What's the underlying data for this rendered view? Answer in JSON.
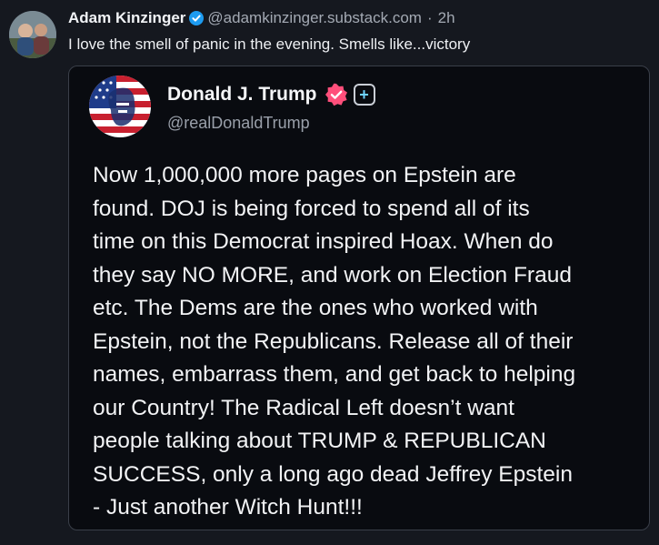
{
  "post": {
    "author_name": "Adam Kinzinger",
    "author_handle": "@adamkinzinger.substack.com",
    "separator": "·",
    "time": "2h",
    "text": "I love the smell of panic in the evening.  Smells like...victory",
    "verified_icon": "verified-check-icon"
  },
  "quote": {
    "author_name": "Donald J. Trump",
    "author_handle": "@realDonaldTrump",
    "verified_icon": "verified-badge-icon",
    "plus_icon": "plus-icon",
    "plus_glyph": "+",
    "body_lines": [
      "Now 1,000,000 more pages on Epstein are",
      "found. DOJ is being forced to spend all of its",
      "time on this Democrat inspired Hoax. When do",
      "they say NO MORE, and work on Election Fraud",
      "etc. The Dems are the ones who worked with",
      "Epstein, not the Republicans. Release all of their",
      "names, embarrass them, and get back to helping",
      "our Country! The Radical Left doesn’t want",
      "people talking about TRUMP & REPUBLICAN",
      "SUCCESS, only a long ago dead Jeffrey Epstein",
      "- Just another Witch Hunt!!!"
    ]
  },
  "colors": {
    "background": "#15181f",
    "card_background": "#090b10",
    "verified_blue": "#1d9bf0",
    "badge_pink": "#ff4f7b"
  }
}
